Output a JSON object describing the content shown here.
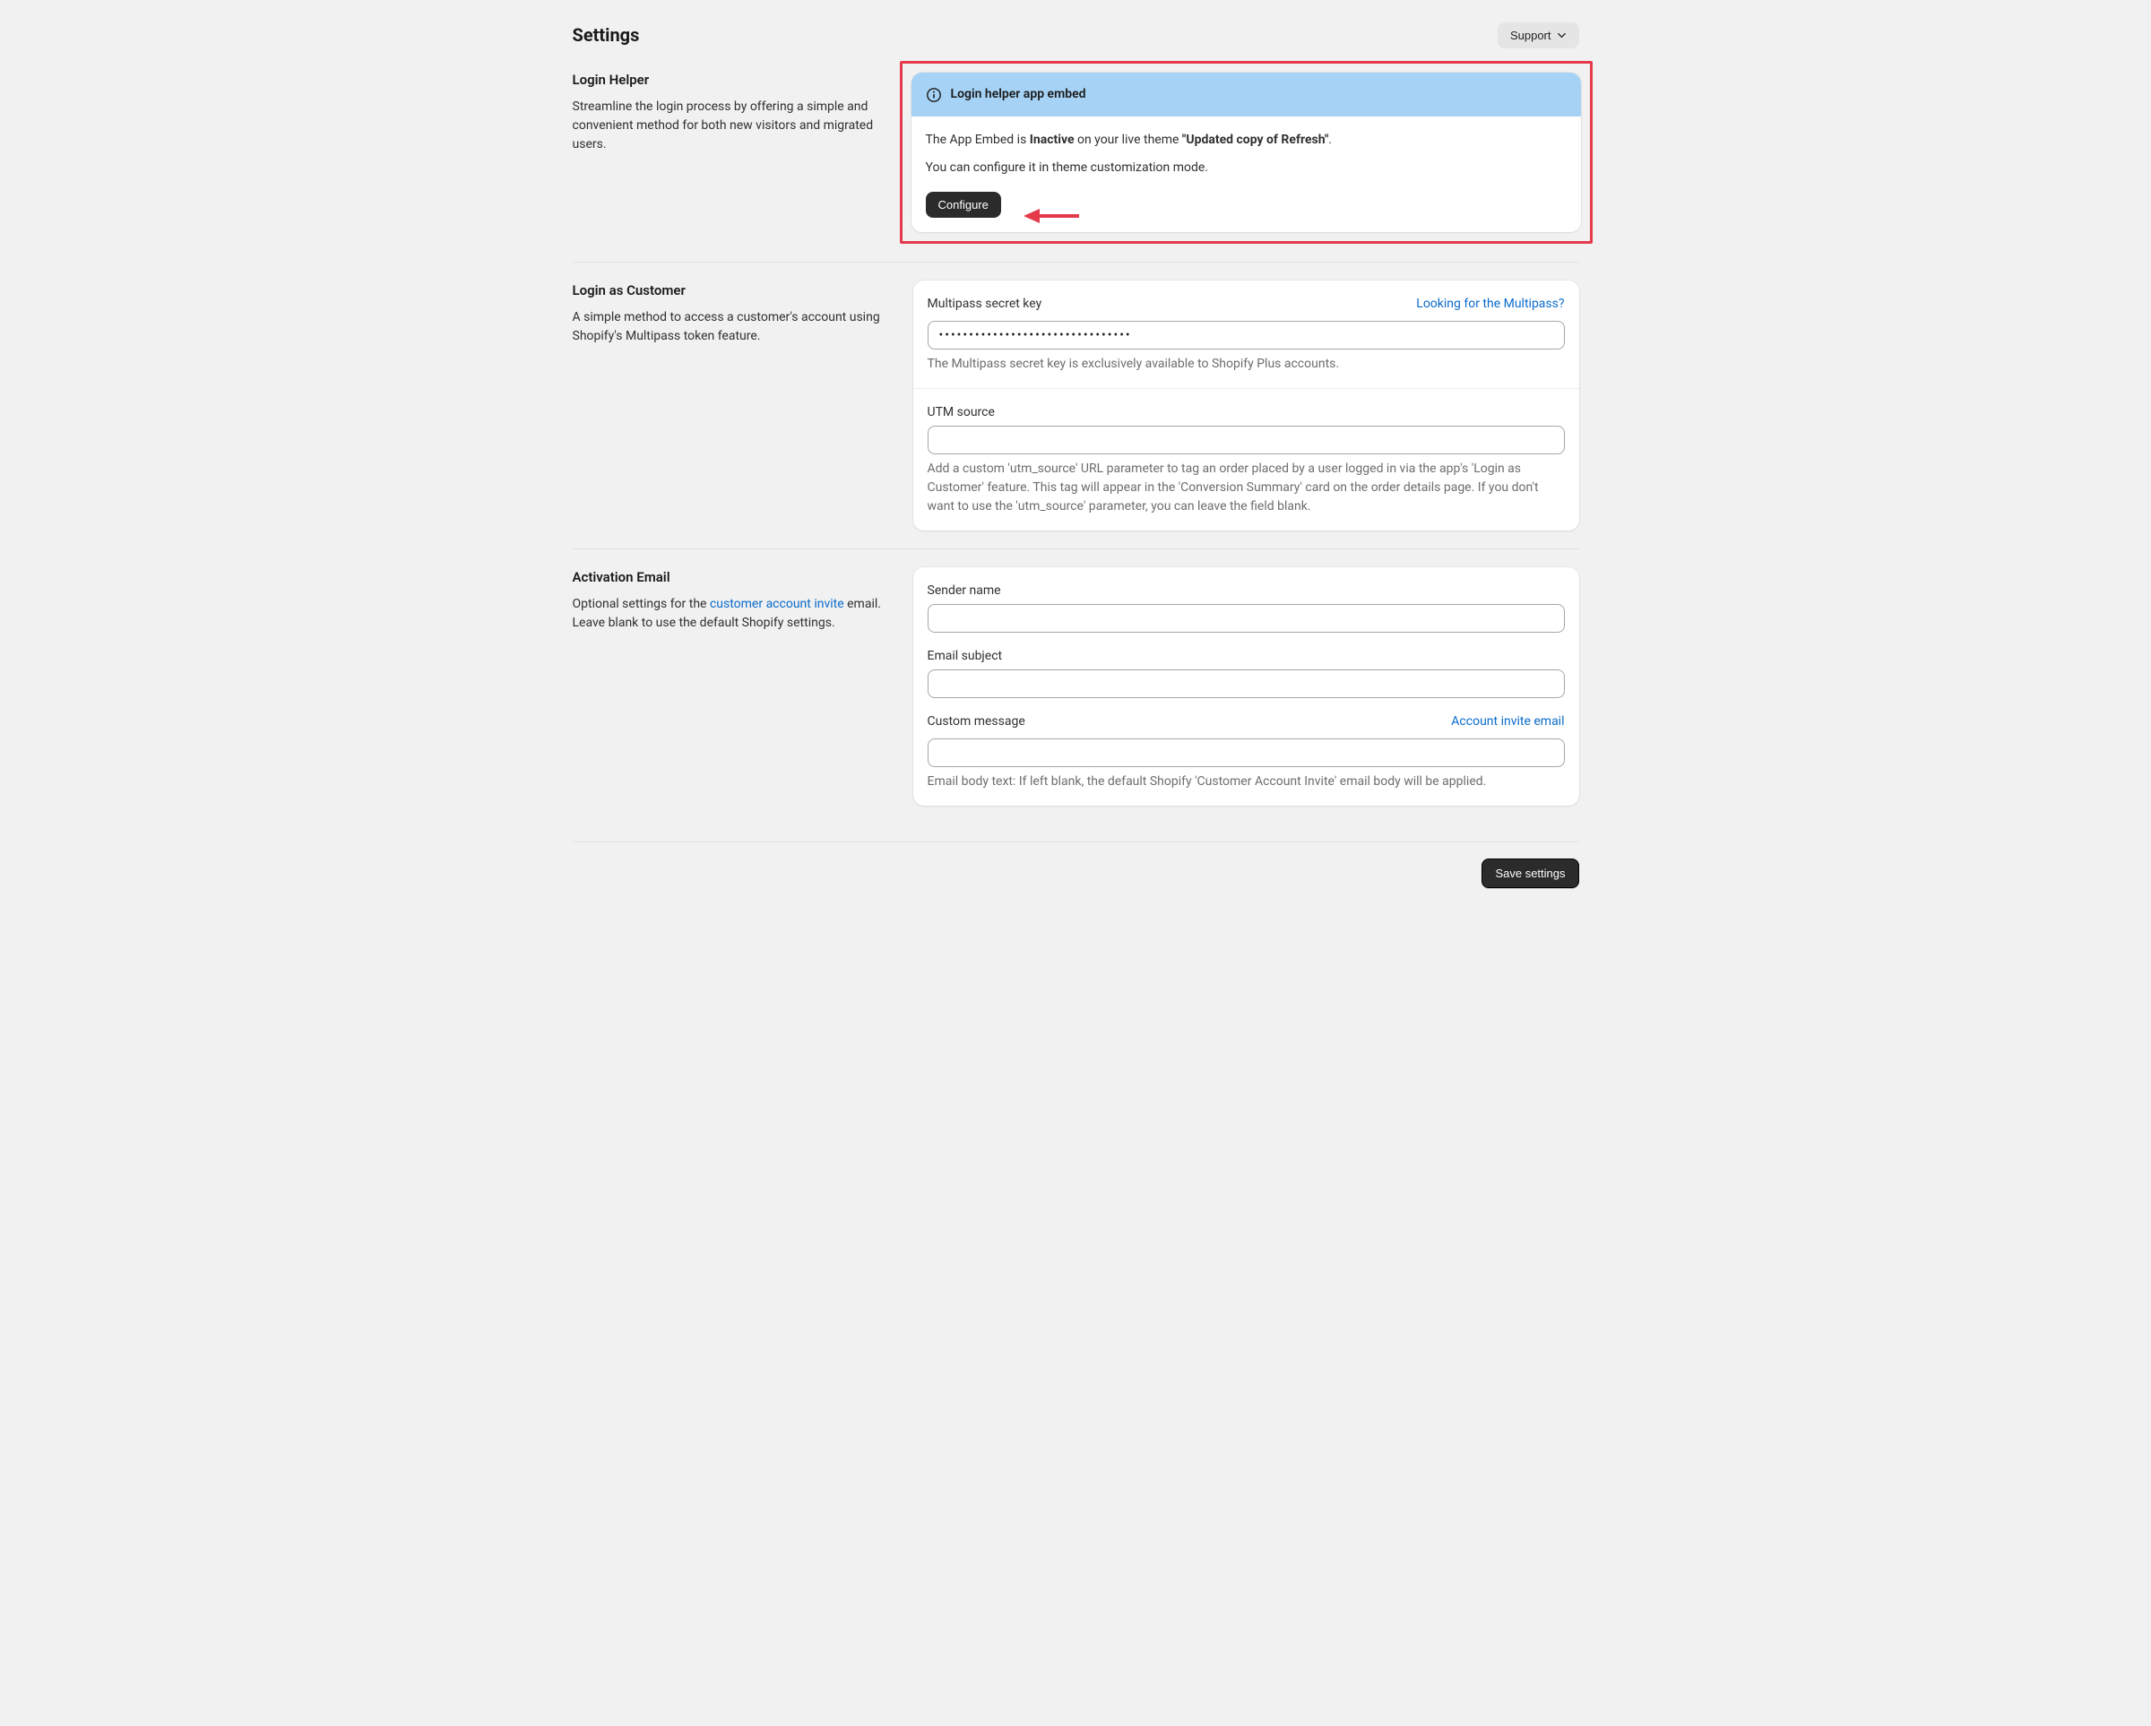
{
  "page": {
    "title": "Settings",
    "support_label": "Support",
    "save_label": "Save settings"
  },
  "login_helper": {
    "title": "Login Helper",
    "desc": "Streamline the login process by offering a simple and convenient method for both new visitors and migrated users.",
    "banner_title": "Login helper app embed",
    "status_prefix": "The App Embed is ",
    "status_word": "Inactive",
    "status_mid": " on your live theme ",
    "theme_name": "\"Updated copy of Refresh\"",
    "status_suffix": ".",
    "config_hint": "You can configure it in theme customization mode.",
    "configure_label": "Configure"
  },
  "login_as_customer": {
    "title": "Login as Customer",
    "desc": "A simple method to access a customer's account using Shopify's Multipass token feature.",
    "multipass_label": "Multipass secret key",
    "multipass_link": "Looking for the Multipass?",
    "multipass_value": "••••••••••••••••••••••••••••••••",
    "multipass_help": "The Multipass secret key is exclusively available to Shopify Plus accounts.",
    "utm_label": "UTM source",
    "utm_value": "",
    "utm_help": "Add a custom 'utm_source' URL parameter to tag an order placed by a user logged in via the app's 'Login as Customer' feature. This tag will appear in the 'Conversion Summary' card on the order details page. If you don't want to use the 'utm_source' parameter, you can leave the field blank."
  },
  "activation_email": {
    "title": "Activation Email",
    "desc_prefix": "Optional settings for the ",
    "desc_link": "customer account invite",
    "desc_suffix": " email. Leave blank to use the default Shopify settings.",
    "sender_label": "Sender name",
    "sender_value": "",
    "subject_label": "Email subject",
    "subject_value": "",
    "custom_label": "Custom message",
    "custom_link": "Account invite email",
    "custom_value": "",
    "custom_help": "Email body text: If left blank, the default Shopify 'Customer Account Invite' email body will be applied."
  }
}
